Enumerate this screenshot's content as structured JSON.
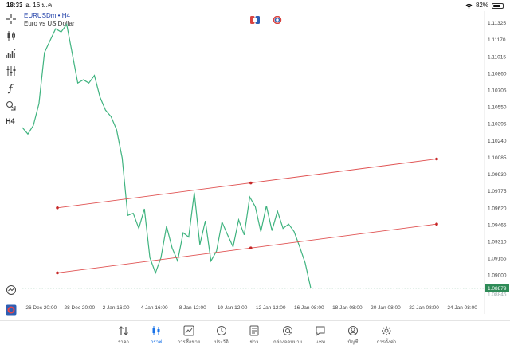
{
  "status": {
    "time": "18:33",
    "date": "อ. 16 ม.ค.",
    "battery": "82%",
    "battery_level": 0.82
  },
  "symbol": {
    "name": "EURUSDm • H4",
    "description": "Euro vs US Dollar"
  },
  "timeframe_label": "H4",
  "price_axis": {
    "labels": [
      "1.11325",
      "1.11170",
      "1.11015",
      "1.10860",
      "1.10705",
      "1.10550",
      "1.10395",
      "1.10240",
      "1.10085",
      "1.09930",
      "1.09775",
      "1.09620",
      "1.09465",
      "1.09310",
      "1.09155",
      "1.09000"
    ],
    "current_price": "1.08879",
    "current_hidden": "1.08845"
  },
  "time_axis": {
    "labels": [
      "26 Dec 20:00",
      "28 Dec 20:00",
      "2 Jan 16:00",
      "4 Jan 16:00",
      "8 Jan 12:00",
      "10 Jan 12:00",
      "12 Jan 12:00",
      "16 Jan 08:00",
      "18 Jan 08:00",
      "20 Jan 08:00",
      "22 Jan 08:00",
      "24 Jan 08:00"
    ]
  },
  "chart_data": {
    "type": "line",
    "series_color": "#3fb37f",
    "channel_color": "#e05252",
    "price_line_color": "#2e8b57",
    "ylim": [
      1.0884,
      1.1141
    ],
    "current_price": 1.08879,
    "x_count": 54,
    "values": [
      1.1036,
      1.103,
      1.1038,
      1.1058,
      1.1105,
      1.1116,
      1.1127,
      1.1124,
      1.1131,
      1.1104,
      1.1077,
      1.108,
      1.1077,
      1.1084,
      1.1064,
      1.1052,
      1.1046,
      1.1034,
      1.1008,
      1.0955,
      1.0957,
      1.0943,
      1.0961,
      1.0916,
      1.0902,
      1.0916,
      1.0945,
      1.0925,
      1.0913,
      1.0939,
      1.0935,
      1.0976,
      1.0928,
      1.095,
      1.0913,
      1.0922,
      1.0949,
      1.0937,
      1.0926,
      1.0951,
      1.0937,
      1.0972,
      1.0963,
      1.094,
      1.0964,
      1.0941,
      1.0959,
      1.0943,
      1.0947,
      1.094,
      1.0926,
      1.0911,
      1.0888
    ],
    "channel_upper": {
      "from": [
        0.0,
        1.0962
      ],
      "to": [
        1.0,
        1.1007
      ],
      "anchor": 0.51
    },
    "channel_lower": {
      "from": [
        0.0,
        1.0902
      ],
      "to": [
        1.0,
        1.0947
      ],
      "anchor": 0.51
    }
  },
  "nav": [
    {
      "key": "quotes",
      "label": "ราคา",
      "icon": "quotes-icon",
      "active": false
    },
    {
      "key": "chart",
      "label": "กราฟ",
      "icon": "chart-icon",
      "active": true
    },
    {
      "key": "trade",
      "label": "การซื้อขาย",
      "icon": "trade-icon",
      "active": false
    },
    {
      "key": "history",
      "label": "ประวัติ",
      "icon": "history-icon",
      "active": false
    },
    {
      "key": "news",
      "label": "ข่าว",
      "icon": "news-icon",
      "active": false
    },
    {
      "key": "mailbox",
      "label": "กล่องจดหมาย",
      "icon": "mailbox-icon",
      "active": false
    },
    {
      "key": "chat",
      "label": "แชท",
      "icon": "chat-icon",
      "active": false
    },
    {
      "key": "account",
      "label": "บัญชี",
      "icon": "account-icon",
      "active": false
    },
    {
      "key": "settings",
      "label": "การตั้งค่า",
      "icon": "settings-icon",
      "active": false
    }
  ]
}
